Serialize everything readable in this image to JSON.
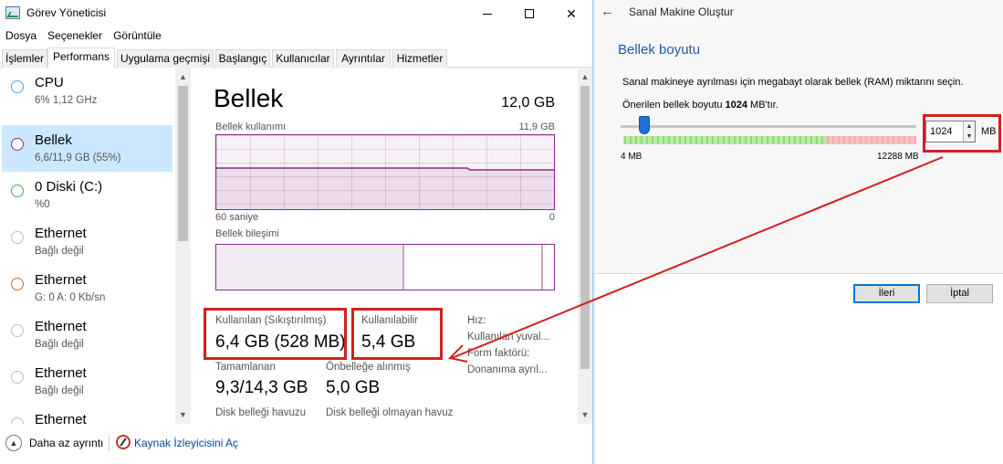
{
  "task_manager": {
    "title": "Görev Yöneticisi",
    "window_buttons": {
      "minimize": "—",
      "maximize": "□",
      "close": "✕"
    },
    "menu": [
      "Dosya",
      "Seçenekler",
      "Görüntüle"
    ],
    "tabs": [
      "İşlemler",
      "Performans",
      "Uygulama geçmişi",
      "Başlangıç",
      "Kullanıcılar",
      "Ayrıntılar",
      "Hizmetler"
    ],
    "active_tab": "Performans",
    "sidebar": [
      {
        "name": "CPU",
        "sub": "6% 1,12 GHz",
        "color": "#4aa3df"
      },
      {
        "name": "Bellek",
        "sub": "6,6/11,9 GB (55%)",
        "color": "#8b2a8b",
        "selected": true
      },
      {
        "name": "0 Diski (C:)",
        "sub": "%0",
        "color": "#4caf50"
      },
      {
        "name": "Ethernet",
        "sub": "Bağlı değil",
        "color": "#a0a0a0"
      },
      {
        "name": "Ethernet",
        "sub": "G: 0 A: 0 Kb/sn",
        "color": "#c86b1e"
      },
      {
        "name": "Ethernet",
        "sub": "Bağlı değil",
        "color": "#a0a0a0"
      },
      {
        "name": "Ethernet",
        "sub": "Bağlı değil",
        "color": "#a0a0a0"
      },
      {
        "name": "Ethernet",
        "sub": "",
        "color": "#a0a0a0"
      }
    ],
    "main": {
      "title": "Bellek",
      "total": "12,0 GB",
      "usage_label": "Bellek kullanımı",
      "usage_max": "11,9 GB",
      "time_label": "60 saniye",
      "time_zero": "0",
      "composition_label": "Bellek bileşimi",
      "in_use_label": "Kullanılan (Sıkıştırılmış)",
      "in_use_value": "6,4 GB (528 MB)",
      "available_label": "Kullanılabilir",
      "available_value": "5,4 GB",
      "committed_label": "Tamamlanan",
      "committed_value": "9,3/14,3 GB",
      "cached_label": "Önbelleğe alınmış",
      "cached_value": "5,0 GB",
      "paged_label": "Disk belleği havuzu",
      "nonpaged_label": "Disk belleği olmayan havuz",
      "speed_label": "Hız:",
      "slots_label": "Kullanılan yuval...",
      "form_label": "Form faktörü:",
      "hw_label": "Donanıma ayrıl..."
    },
    "footer": {
      "fewer": "Daha az ayrıntı",
      "resmon": "Kaynak İzleyicisini Aç"
    }
  },
  "wizard": {
    "title": "Sanal Makine Oluştur",
    "heading": "Bellek boyutu",
    "description": "Sanal makineye ayrılması için megabayt olarak bellek (RAM) miktarını seçin.",
    "rec_prefix": "Önerilen bellek boyutu ",
    "rec_value": "1024",
    "rec_suffix": " MB'tır.",
    "slider_level": 0.08,
    "min_label": "4 MB",
    "max_label": "12288 MB",
    "spin_value": "1024",
    "unit": "MB",
    "next_button": "İleri",
    "cancel_button": "İptal",
    "range_colors": {
      "green": "#7ed957",
      "light_green": "#c7f0b5",
      "red": "#f5a3a3"
    }
  },
  "annotation_color": "#d21f1f"
}
